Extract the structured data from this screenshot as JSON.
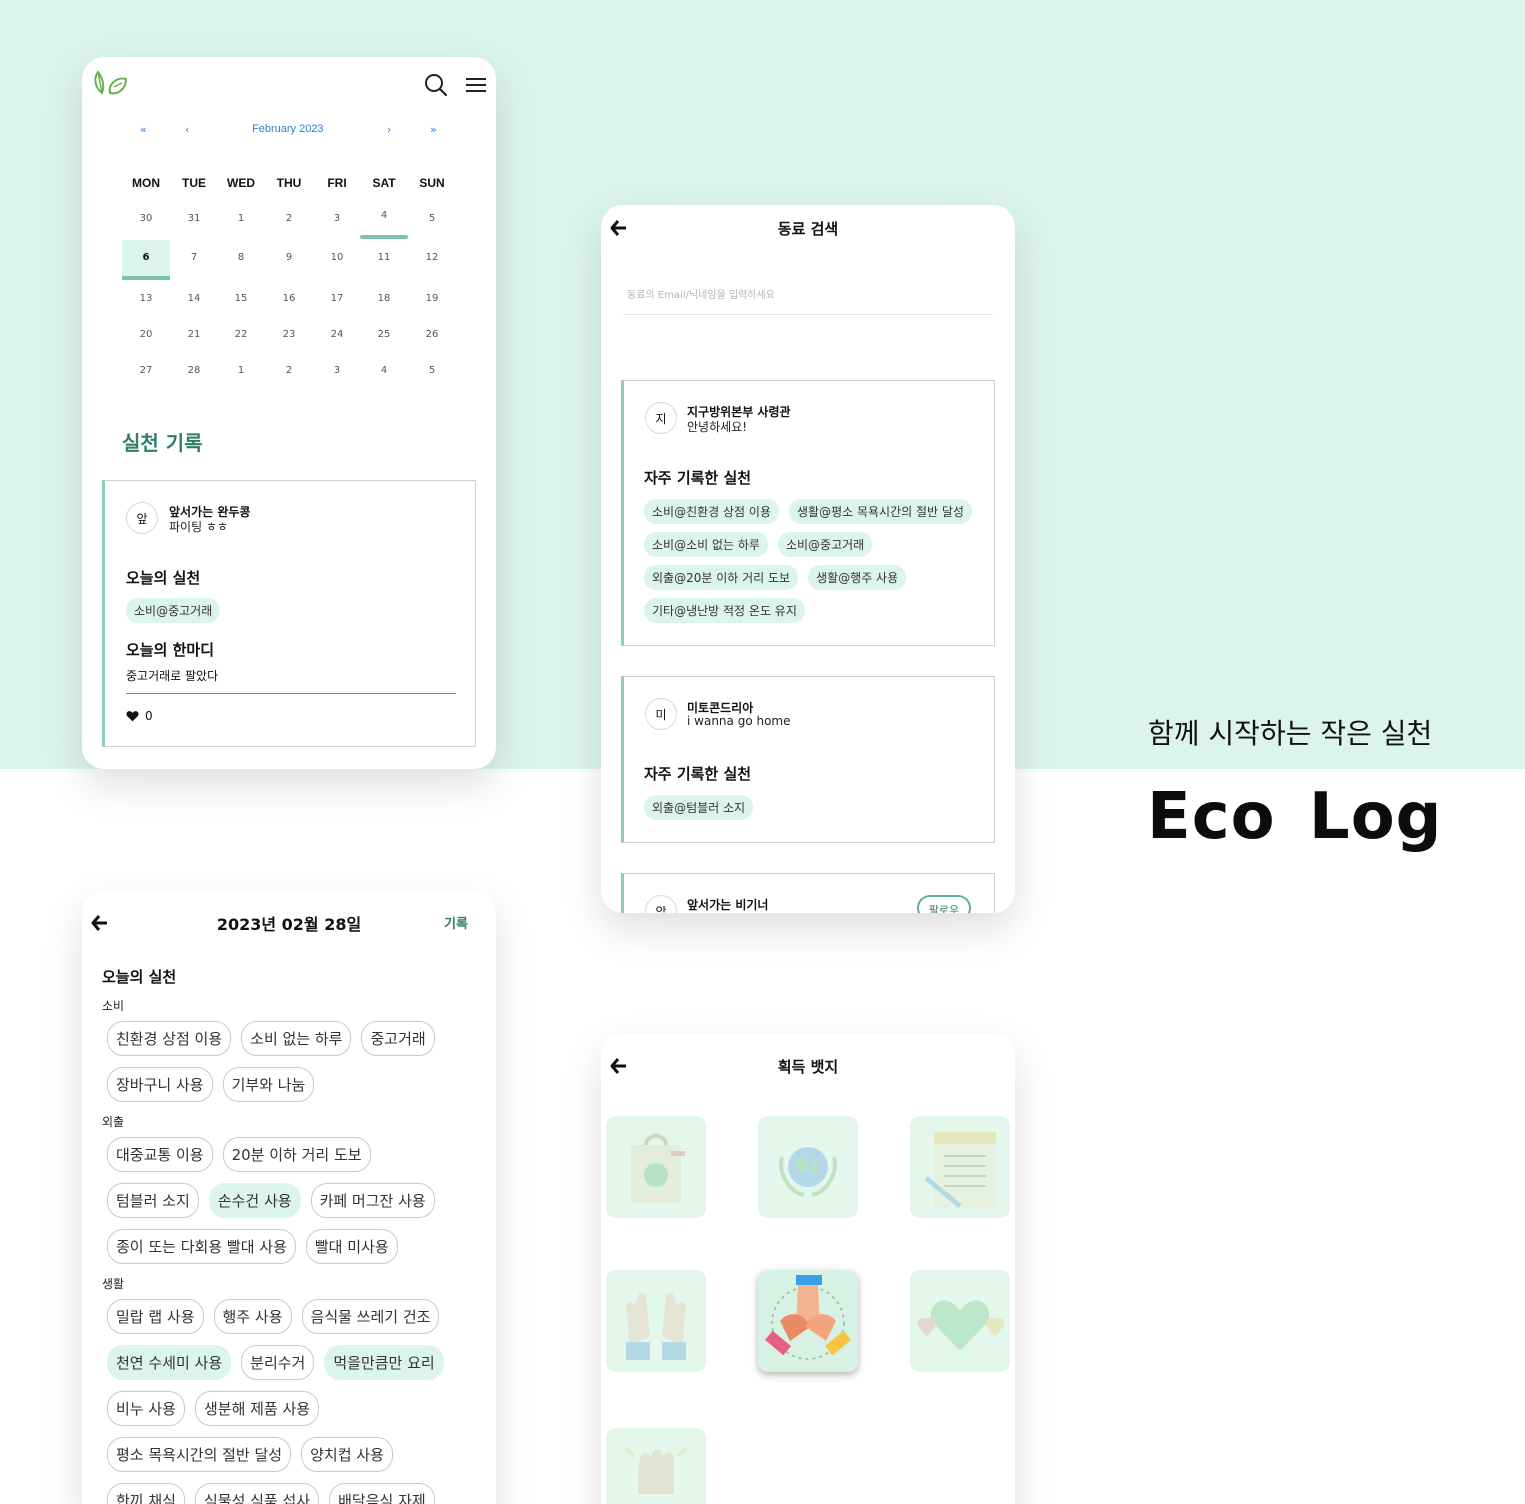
{
  "colors": {
    "mint_bg": "#dcf5ea",
    "accent": "#2e7e6a",
    "month_link": "#2d7fd6",
    "chip_bg": "#dcf5ea"
  },
  "calendar_screen": {
    "nav": {
      "prev_year": "«",
      "prev_month": "‹",
      "month_label": "February 2023",
      "next_month": "›",
      "next_year": "»"
    },
    "weekdays": [
      "MON",
      "TUE",
      "WED",
      "THU",
      "FRI",
      "SAT",
      "SUN"
    ],
    "weeks": [
      [
        "30",
        "31",
        "1",
        "2",
        "3",
        "4",
        "5"
      ],
      [
        "6",
        "7",
        "8",
        "9",
        "10",
        "11",
        "12"
      ],
      [
        "13",
        "14",
        "15",
        "16",
        "17",
        "18",
        "19"
      ],
      [
        "20",
        "21",
        "22",
        "23",
        "24",
        "25",
        "26"
      ],
      [
        "27",
        "28",
        "1",
        "2",
        "3",
        "4",
        "5"
      ]
    ],
    "selected_day": "6",
    "section_title": "실천 기록",
    "record": {
      "avatar": "앞",
      "name": "앞서가는 완두콩",
      "bio": "파이팅 ㅎㅎ",
      "practice_heading": "오늘의 실천",
      "practice_tag": "소비@중고거래",
      "comment_heading": "오늘의 한마디",
      "comment": "중고거래로 팔았다",
      "like_count": "0"
    }
  },
  "search_screen": {
    "title": "동료 검색",
    "search_placeholder": "동료의 Email/닉네임을 입력하세요",
    "results": [
      {
        "avatar": "지",
        "name": "지구방위본부 사령관",
        "bio": "안녕하세요!",
        "heading": "자주 기록한 실천",
        "tags": [
          "소비@친환경 상점 이용",
          "생활@평소 목욕시간의 절반 달성",
          "소비@소비 없는 하루",
          "소비@중고거래",
          "외출@20분 이하 거리 도보",
          "생활@행주 사용",
          "기타@냉난방 적정 온도 유지"
        ]
      },
      {
        "avatar": "미",
        "name": "미토콘드리아",
        "bio": "i wanna go home",
        "heading": "자주 기록한 실천",
        "tags": [
          "외출@텀블러 소지"
        ]
      },
      {
        "avatar": "앞",
        "name": "앞서가는 비기너",
        "follow_label": "팔로우"
      }
    ]
  },
  "record_screen": {
    "date": "2023년 02월 28일",
    "save_label": "기록",
    "heading": "오늘의 실천",
    "categories": [
      {
        "name": "소비",
        "options": [
          "친환경 상점 이용",
          "소비 없는 하루",
          "중고거래",
          "장바구니 사용",
          "기부와 나눔"
        ]
      },
      {
        "name": "외출",
        "options": [
          "대중교통 이용",
          "20분 이하 거리 도보",
          "텀블러 소지",
          "손수건 사용",
          "카페 머그잔 사용",
          "종이 또는 다회용 빨대 사용",
          "빨대 미사용"
        ]
      },
      {
        "name": "생활",
        "options": [
          "밀랍 랩 사용",
          "행주 사용",
          "음식물 쓰레기 건조",
          "천연 수세미 사용",
          "분리수거",
          "먹을만큼만 요리",
          "비누 사용",
          "생분해 제품 사용",
          "평소 목욕시간의 절반 달성",
          "양치컵 사용",
          "한끼 채식",
          "식물성 식품 섭사",
          "배달음식 자제"
        ]
      }
    ],
    "selected_options": [
      "손수건 사용",
      "천연 수세미 사용",
      "먹을만큼만 요리"
    ]
  },
  "badge_screen": {
    "title": "획득 뱃지",
    "badges": [
      {
        "icon": "shopping-bag-badge-icon",
        "earned": false
      },
      {
        "icon": "globe-laurel-badge-icon",
        "earned": false
      },
      {
        "icon": "notepad-badge-icon",
        "earned": false
      },
      {
        "icon": "clapping-hands-badge-icon",
        "earned": false
      },
      {
        "icon": "stacked-hands-badge-icon",
        "earned": true
      },
      {
        "icon": "hearts-badge-icon",
        "earned": false
      },
      {
        "icon": "raised-fist-badge-icon",
        "earned": false
      }
    ]
  },
  "tagline": "함께 시작하는 작은 실천",
  "brand": "Eco Log"
}
